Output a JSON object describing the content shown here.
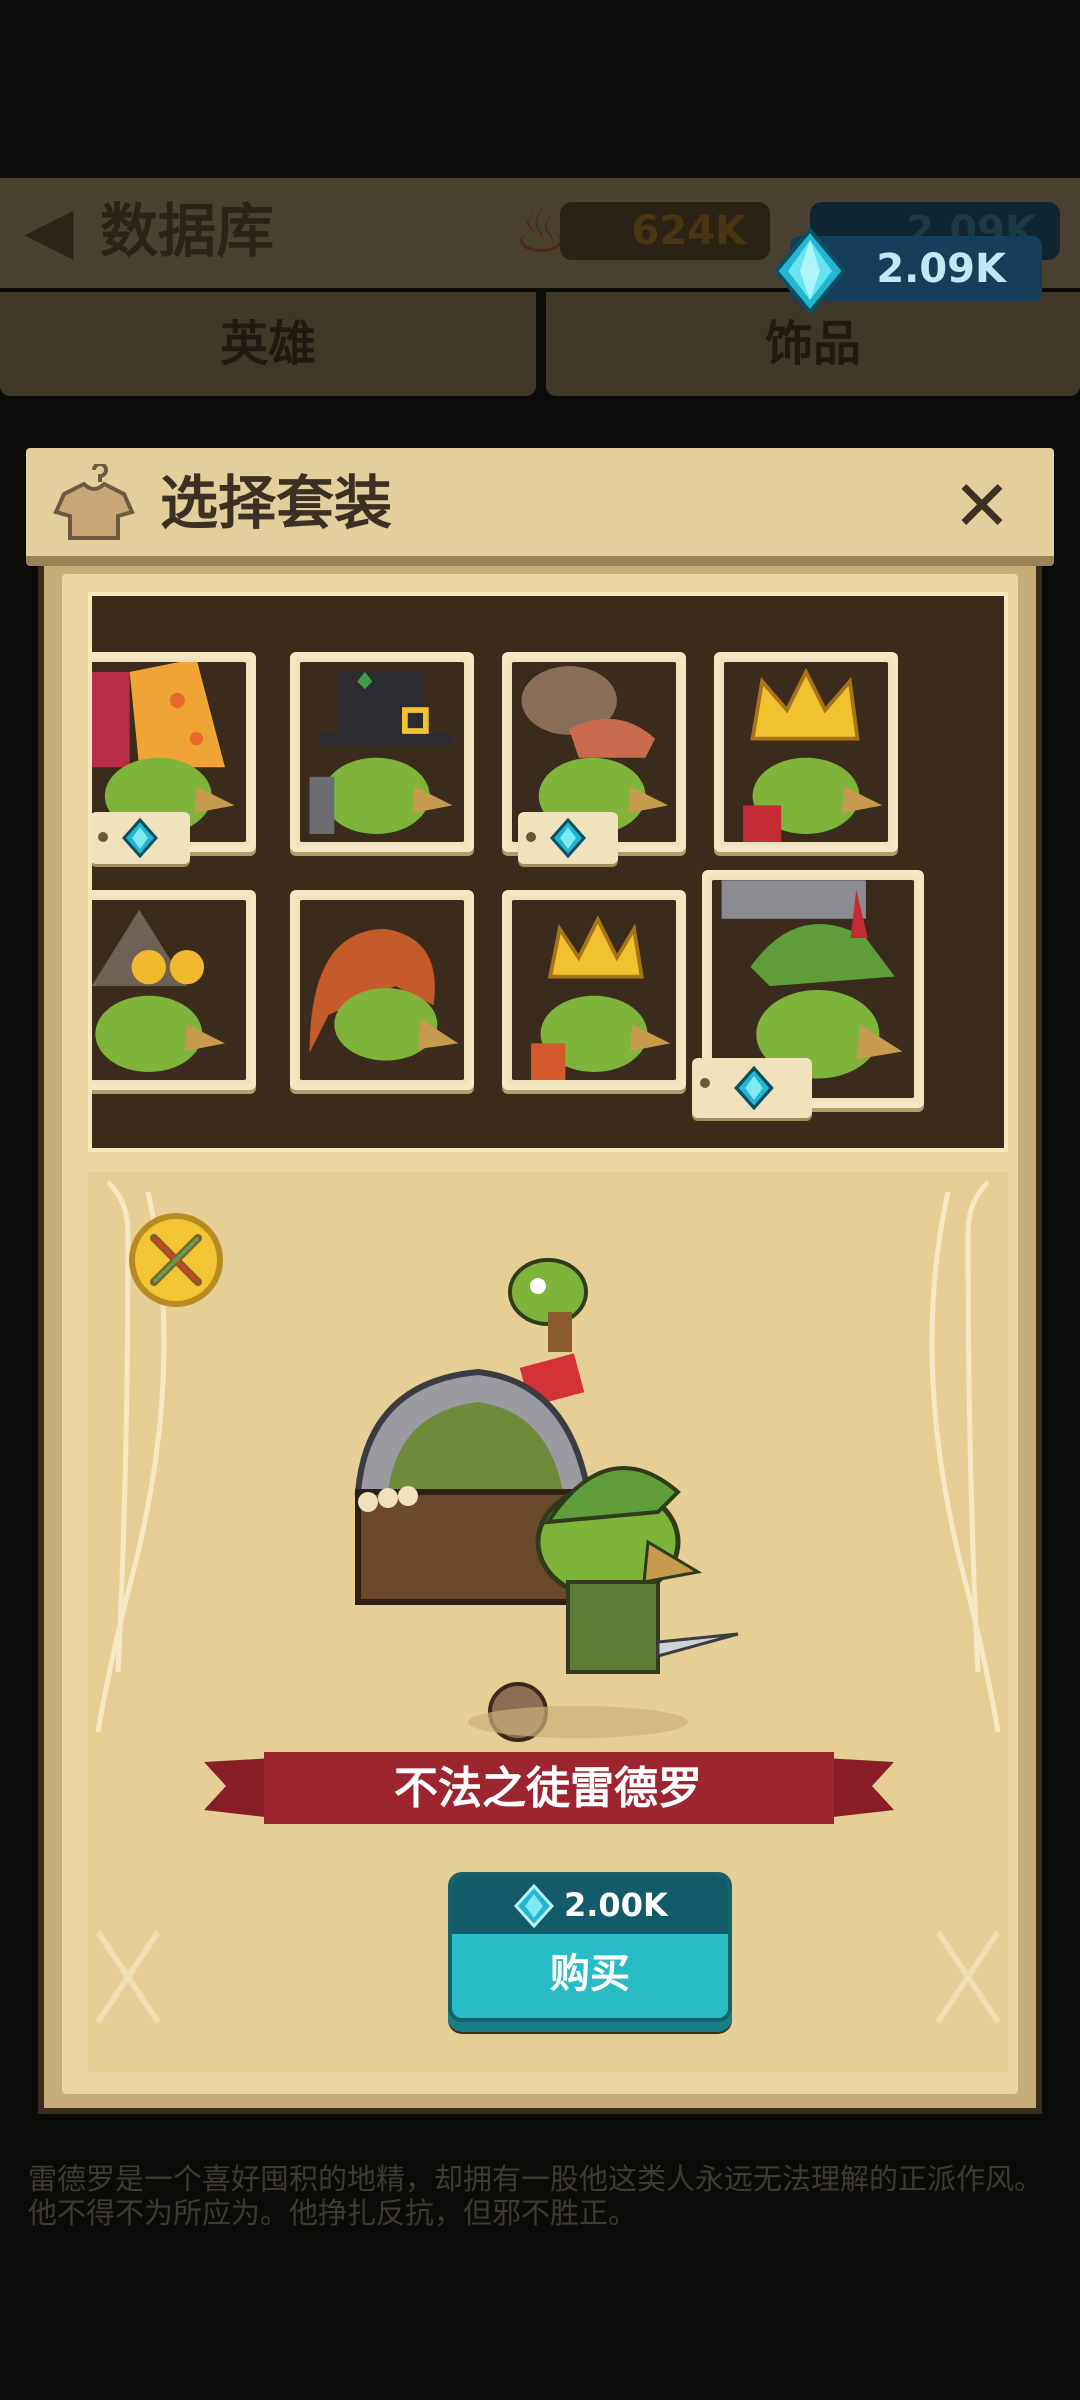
{
  "background": {
    "title": "数据库",
    "gold_value": "624K",
    "gem_value": "2.09K",
    "tabs": [
      "英雄",
      "饰品"
    ],
    "description": "雷德罗是一个喜好囤积的地精，却拥有一股他这类人永远无法理解的正派作风。他不得不为所应为。他挣扎反抗，但邪不胜正。"
  },
  "currency": {
    "gems": "2.09K",
    "icon": "gem-icon"
  },
  "popup": {
    "title": "选择套装",
    "title_icon": "shirt-hanger-icon",
    "close_icon": "close-icon"
  },
  "outfits": [
    {
      "id": "party-hat",
      "paid": true,
      "selected": false
    },
    {
      "id": "pilgrim-hat",
      "paid": false,
      "selected": false
    },
    {
      "id": "cap",
      "paid": true,
      "selected": false
    },
    {
      "id": "gold-crown",
      "paid": false,
      "selected": false
    },
    {
      "id": "goggles-hat",
      "paid": false,
      "selected": false
    },
    {
      "id": "red-hood",
      "paid": false,
      "selected": false
    },
    {
      "id": "spiky-crown",
      "paid": false,
      "selected": false
    },
    {
      "id": "green-feather-hat",
      "paid": true,
      "selected": true
    }
  ],
  "preview": {
    "skin_name": "不法之徒雷德罗",
    "price": "2.00K",
    "buy_label": "购买",
    "toggle_icon": "crossed-swords-icon"
  },
  "colors": {
    "gem": "#3fd0e0",
    "ribbon": "#9c2530",
    "buy_button": "#2abcc6",
    "parchment": "#ead6a0"
  }
}
